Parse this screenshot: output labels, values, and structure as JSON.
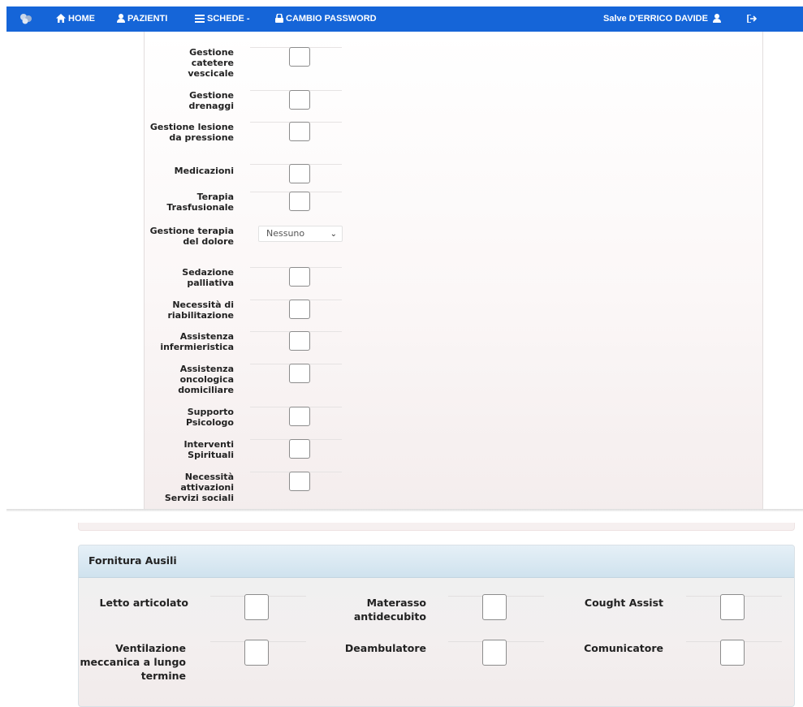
{
  "navbar": {
    "home": "HOME",
    "pazienti": "PAZIENTI",
    "schede": "SCHEDE -",
    "cambio_password": "CAMBIO PASSWORD",
    "greeting": "Salve D'ERRICO DAVIDE",
    "color": "#1565d8"
  },
  "form_items": [
    {
      "label": "Gestione catetere vescicale",
      "type": "checkbox"
    },
    {
      "label": "Gestione drenaggi",
      "type": "checkbox"
    },
    {
      "label": "Gestione lesione da pressione",
      "type": "checkbox"
    },
    {
      "label": "Medicazioni",
      "type": "checkbox"
    },
    {
      "label": "Terapia Trasfusionale",
      "type": "checkbox"
    },
    {
      "label": "Gestione terapia del dolore",
      "type": "select",
      "value": "Nessuno"
    },
    {
      "label": "Sedazione palliativa",
      "type": "checkbox"
    },
    {
      "label": "Necessità di riabilitazione",
      "type": "checkbox"
    },
    {
      "label": "Assistenza infermieristica",
      "type": "checkbox"
    },
    {
      "label": "Assistenza oncologica domiciliare",
      "type": "checkbox"
    },
    {
      "label": "Supporto Psicologo",
      "type": "checkbox"
    },
    {
      "label": "Interventi Spirituali",
      "type": "checkbox"
    },
    {
      "label": "Necessità attivazioni Servizi sociali",
      "type": "checkbox"
    }
  ],
  "ausili": {
    "title": "Fornitura Ausili",
    "items": [
      {
        "label": "Letto articolato"
      },
      {
        "label": "Materasso antidecubito"
      },
      {
        "label": "Cought Assist"
      },
      {
        "label": "Ventilazione meccanica a lungo termine"
      },
      {
        "label": "Deambulatore"
      },
      {
        "label": "Comunicatore"
      }
    ]
  }
}
